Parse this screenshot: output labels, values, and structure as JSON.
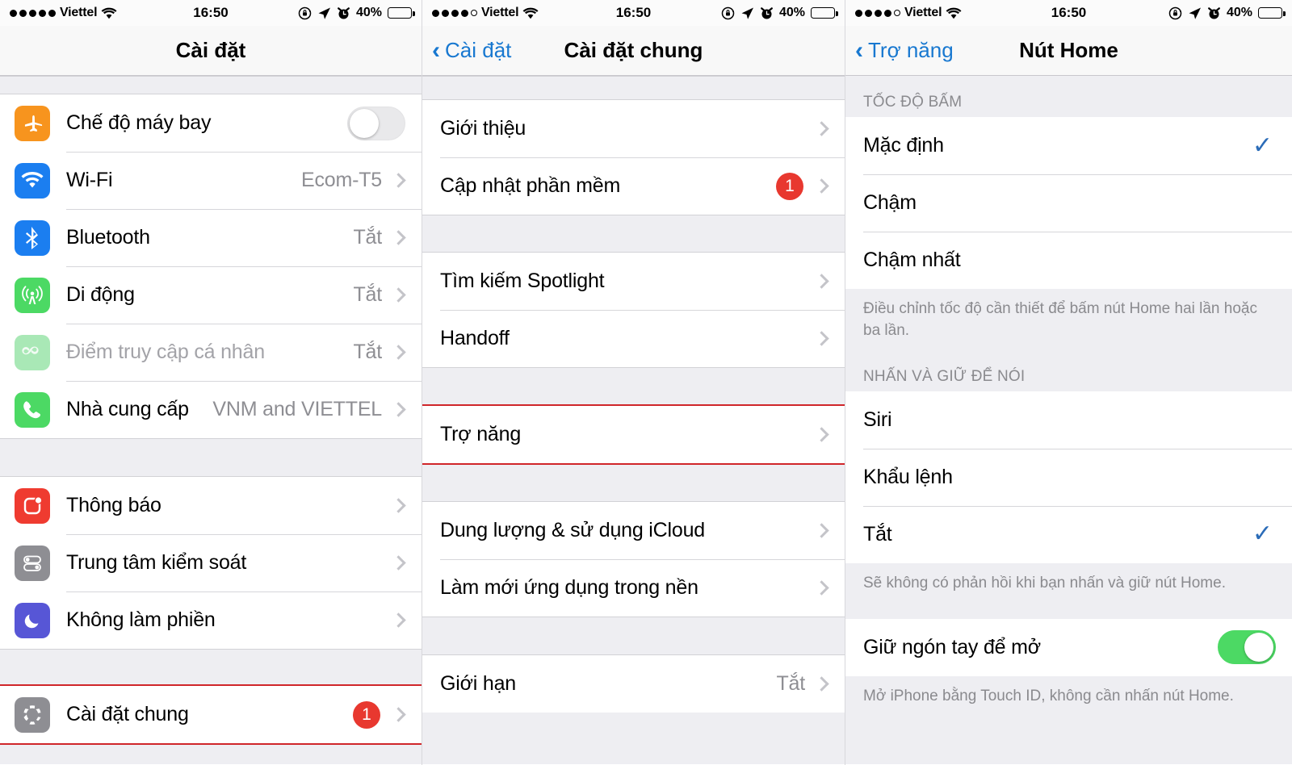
{
  "statusbar": {
    "carrier": "Viettel",
    "time": "16:50",
    "battery_percent": "40%",
    "signal_dots_filled_p1": 5,
    "signal_dots_filled_p2": 4,
    "signal_dots_filled_p3": 4,
    "icons": [
      "rotation-lock-icon",
      "location-arrow-icon",
      "alarm-clock-icon",
      "wifi-icon"
    ]
  },
  "colors": {
    "accent_blue": "#1878d0",
    "check_blue": "#2b6cb8",
    "badge_red": "#e8382f",
    "highlight_red": "#d0262a",
    "toggle_green": "#4cd964",
    "group_bg": "#eeeef2"
  },
  "panel1": {
    "title": "Cài đặt",
    "groups": [
      {
        "rows": [
          {
            "label": "Chế độ máy bay",
            "icon": "airplane-icon",
            "icon_color": "#f7941e",
            "control": "toggle",
            "toggle_on": false
          },
          {
            "label": "Wi-Fi",
            "icon": "wifi-icon",
            "icon_color": "#1b7ef0",
            "value": "Ecom-T5",
            "control": "chevron"
          },
          {
            "label": "Bluetooth",
            "icon": "bluetooth-icon",
            "icon_color": "#1b7ef0",
            "value": "Tắt",
            "control": "chevron"
          },
          {
            "label": "Di động",
            "icon": "cellular-icon",
            "icon_color": "#4cd964",
            "value": "Tắt",
            "control": "chevron"
          },
          {
            "label": "Điểm truy cập cá nhân",
            "icon": "hotspot-icon",
            "icon_color": "#a9e8b6",
            "value": "Tắt",
            "control": "chevron",
            "dimmed": true
          },
          {
            "label": "Nhà cung cấp",
            "icon": "phone-icon",
            "icon_color": "#4cd964",
            "value": "VNM and VIETTEL",
            "control": "chevron"
          }
        ]
      },
      {
        "rows": [
          {
            "label": "Thông báo",
            "icon": "notifications-icon",
            "icon_color": "#ef3b30",
            "control": "chevron"
          },
          {
            "label": "Trung tâm kiểm soát",
            "icon": "control-center-icon",
            "icon_color": "#8e8e93",
            "control": "chevron"
          },
          {
            "label": "Không làm phiền",
            "icon": "do-not-disturb-icon",
            "icon_color": "#5756d6",
            "control": "chevron"
          }
        ]
      },
      {
        "rows": [
          {
            "label": "Cài đặt chung",
            "icon": "gear-icon",
            "icon_color": "#8e8e93",
            "badge": "1",
            "control": "chevron",
            "highlighted": true
          }
        ]
      }
    ]
  },
  "panel2": {
    "back_label": "Cài đặt",
    "title": "Cài đặt chung",
    "groups": [
      {
        "rows": [
          {
            "label": "Giới thiệu",
            "control": "chevron"
          },
          {
            "label": "Cập nhật phần mềm",
            "badge": "1",
            "control": "chevron"
          }
        ]
      },
      {
        "rows": [
          {
            "label": "Tìm kiếm Spotlight",
            "control": "chevron"
          },
          {
            "label": "Handoff",
            "control": "chevron"
          }
        ]
      },
      {
        "rows": [
          {
            "label": "Trợ năng",
            "control": "chevron",
            "highlighted": true
          }
        ]
      },
      {
        "rows": [
          {
            "label": "Dung lượng & sử dụng iCloud",
            "control": "chevron"
          },
          {
            "label": "Làm mới ứng dụng trong nền",
            "control": "chevron"
          }
        ]
      },
      {
        "rows": [
          {
            "label": "Giới hạn",
            "value": "Tắt",
            "control": "chevron"
          }
        ]
      }
    ]
  },
  "panel3": {
    "back_label": "Trợ năng",
    "title": "Nút Home",
    "sections": [
      {
        "header": "TỐC ĐỘ BẤM",
        "rows": [
          {
            "label": "Mặc định",
            "checked": true
          },
          {
            "label": "Chậm",
            "checked": false
          },
          {
            "label": "Chậm nhất",
            "checked": false
          }
        ],
        "footer": "Điều chỉnh tốc độ cần thiết để bấm nút Home hai lần hoặc ba lần."
      },
      {
        "header": "NHẤN VÀ GIỮ ĐỂ NÓI",
        "rows": [
          {
            "label": "Siri",
            "checked": false
          },
          {
            "label": "Khẩu lệnh",
            "checked": false
          },
          {
            "label": "Tắt",
            "checked": true
          }
        ],
        "footer": "Sẽ không có phản hồi khi bạn nhấn và giữ nút Home."
      },
      {
        "header": "",
        "rows": [
          {
            "label": "Giữ ngón tay để mở",
            "control": "toggle",
            "toggle_on": true
          }
        ],
        "footer": "Mở iPhone bằng Touch ID, không cần nhấn nút Home."
      }
    ]
  }
}
